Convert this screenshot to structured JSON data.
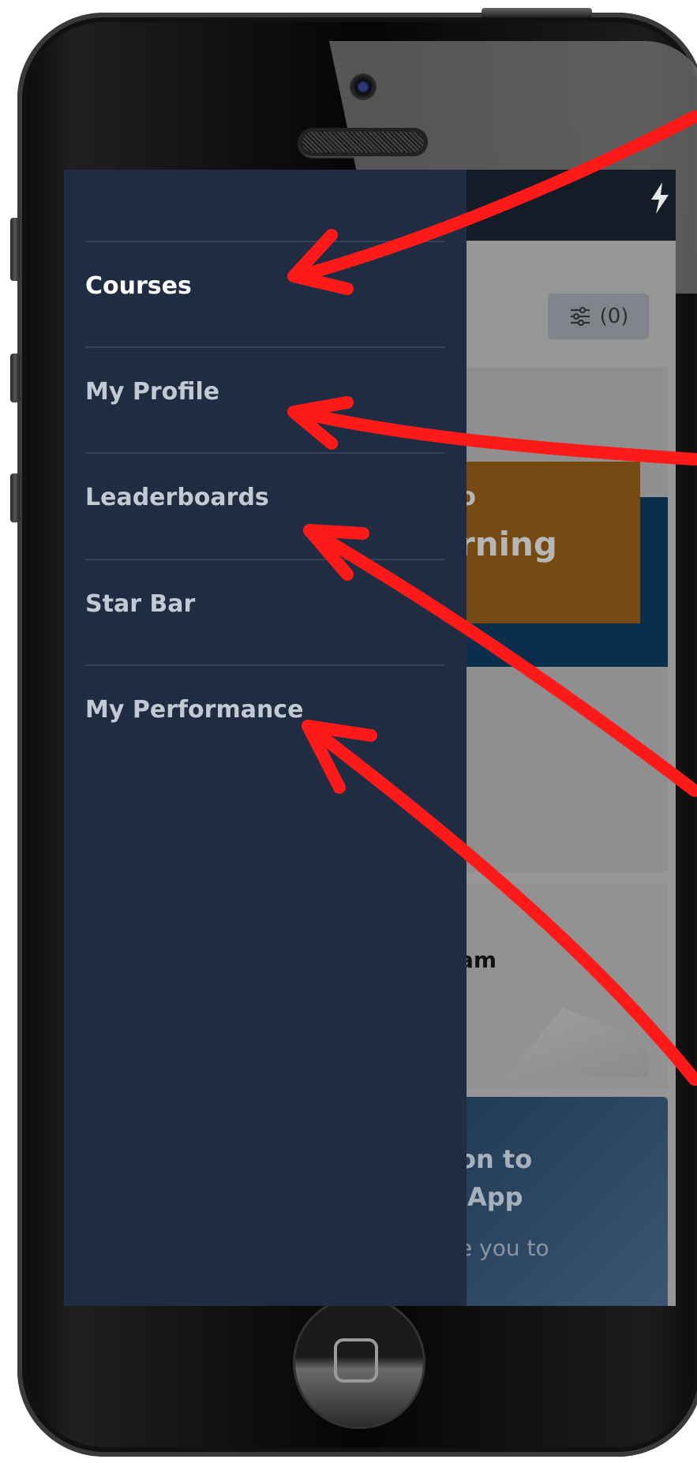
{
  "background_app": {
    "filter_label": "(0)",
    "banner_text_top": "o",
    "banner_text": "rning",
    "card_title_fragment": "am",
    "promo_title": "on to\nlApp",
    "promo_subtitle": "e you to"
  },
  "drawer": {
    "items": [
      {
        "label": "Courses",
        "active": true
      },
      {
        "label": "My Profile",
        "active": false
      },
      {
        "label": "Leaderboards",
        "active": false
      },
      {
        "label": "Star Bar",
        "active": false
      },
      {
        "label": "My Performance",
        "active": false
      }
    ]
  },
  "colors": {
    "drawer_bg": "#1f2c42",
    "active_text": "#ffffff",
    "inactive_text": "#c3c9d2",
    "annotation_arrow": "#ff1a1a"
  },
  "icons": [
    "bolt-icon",
    "sliders-icon",
    "home-button-icon"
  ]
}
